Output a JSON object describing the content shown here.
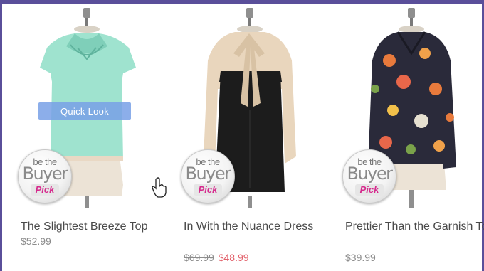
{
  "products": [
    {
      "name": "The Slightest Breeze Top",
      "price": "$52.99",
      "badge": {
        "line1": "be the",
        "line2": "Buyer",
        "line3": "Pick"
      },
      "image_icon": "mint-cutout-top-on-dress-form",
      "colors": {
        "garment": "#9fe3cf",
        "trim": "#e9d8c4"
      }
    },
    {
      "name": "In With the Nuance Dress",
      "original_price": "$69.99",
      "sale_price": "$48.99",
      "badge": {
        "line1": "be the",
        "line2": "Buyer",
        "line3": "Pick"
      },
      "image_icon": "black-cream-bow-dress-on-dress-form",
      "colors": {
        "garment": "#1c1c1c",
        "sleeves": "#e9d6bd"
      }
    },
    {
      "name": "Prettier Than the Garnish Top",
      "price": "$39.99",
      "badge": {
        "line1": "be the",
        "line2": "Buyer",
        "line3": "Pick"
      },
      "image_icon": "floral-print-blouse-on-dress-form",
      "colors": {
        "garment": "#2a2a3a",
        "flowers": "#e87a3c"
      }
    }
  ],
  "overlay": {
    "quick_look": "Quick Look"
  },
  "colors": {
    "frame": "#5a4f9a",
    "sale": "#e2616b",
    "badge_pick": "#d62a8d"
  }
}
